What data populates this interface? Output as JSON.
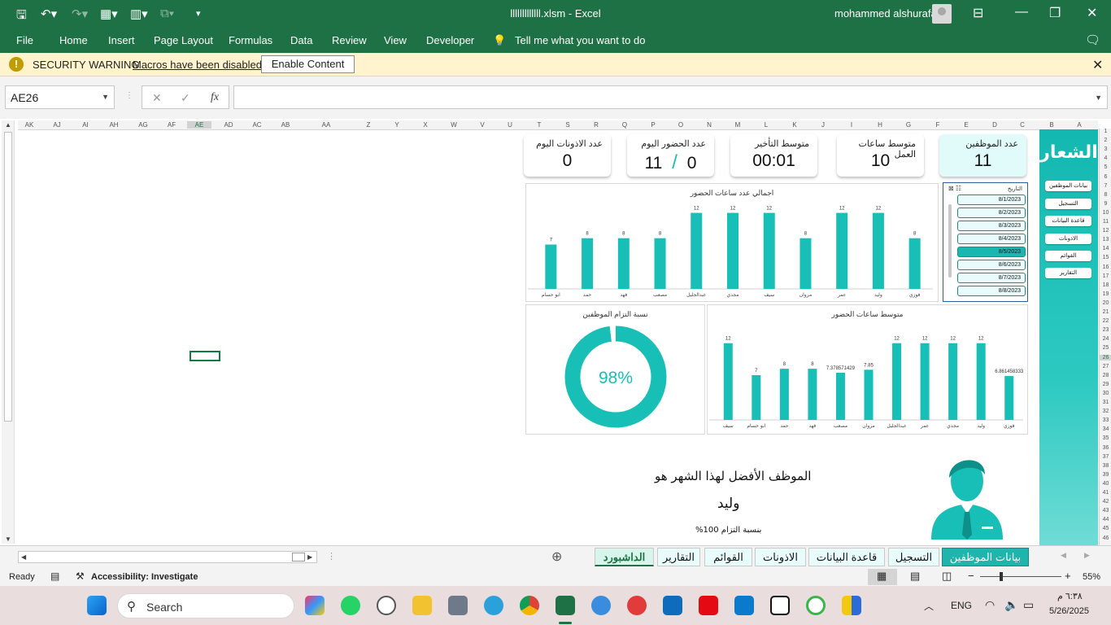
{
  "titlebar": {
    "doc_title": "lllllllllllll.xlsm  -  Excel",
    "user_name": "mohammed alshurafa"
  },
  "menu": [
    "File",
    "Home",
    "Insert",
    "Page Layout",
    "Formulas",
    "Data",
    "Review",
    "View",
    "Developer"
  ],
  "tell_me": "Tell me what you want to do",
  "security": {
    "title": "SECURITY WARNING",
    "message": "Macros have been disabled.",
    "button": "Enable Content"
  },
  "formula_bar": {
    "name_box": "AE26",
    "cancel_glyph": "✕",
    "enter_glyph": "✓",
    "fx_label": "fx",
    "value": ""
  },
  "column_headers": [
    "AK",
    "AJ",
    "AI",
    "AH",
    "AG",
    "AF",
    "AE",
    "AD",
    "AC",
    "AB",
    "AA",
    "Z",
    "Y",
    "X",
    "W",
    "V",
    "U",
    "T",
    "S",
    "R",
    "Q",
    "P",
    "O",
    "N",
    "M",
    "L",
    "K",
    "J",
    "I",
    "H",
    "G",
    "F",
    "E",
    "D",
    "C",
    "B",
    "A"
  ],
  "row_headers": [
    "1",
    "2",
    "3",
    "4",
    "5",
    "6",
    "7",
    "8",
    "9",
    "10",
    "11",
    "12",
    "13",
    "14",
    "15",
    "16",
    "17",
    "18",
    "19",
    "20",
    "21",
    "22",
    "23",
    "24",
    "25",
    "26",
    "27",
    "28",
    "29",
    "30",
    "31",
    "32",
    "33",
    "34",
    "35",
    "36",
    "37",
    "38",
    "39",
    "40",
    "41",
    "42",
    "43",
    "44",
    "45",
    "46"
  ],
  "sidebar": {
    "logo": "الشعار",
    "buttons": [
      "بيانات الموظفين",
      "التسجيل",
      "قاعدة البيانات",
      "الاذونات",
      "القوائم",
      "التقارير"
    ]
  },
  "kpis": [
    {
      "title": "عدد الموظفين",
      "value": "11"
    },
    {
      "title": "متوسط ساعات العمل",
      "value": "10"
    },
    {
      "title": "متوسط التأخير",
      "value": "00:01"
    },
    {
      "title": "عدد الحضور اليوم",
      "value_left": "11",
      "value_sep": "/",
      "value_right": "0"
    },
    {
      "title": "عدد الاذونات اليوم",
      "value": "0"
    }
  ],
  "slicer": {
    "header": "التاريخ",
    "items": [
      "8/1/2023",
      "8/2/2023",
      "8/3/2023",
      "8/4/2023",
      "8/5/2023",
      "8/6/2023",
      "8/7/2023",
      "8/8/2023"
    ],
    "selected_index": 4
  },
  "chart_data": [
    {
      "type": "bar",
      "title": "اجمالي عدد ساعات الحضور",
      "categories": [
        "فوزي",
        "وليد",
        "عمر",
        "مروان",
        "سيف",
        "مجدي",
        "عبدالجليل",
        "مصعب",
        "فهد",
        "حمد",
        "ابو حسام"
      ],
      "values": [
        8,
        12,
        12,
        8,
        12,
        12,
        12,
        8,
        8,
        8,
        7
      ],
      "data_labels": [
        "8",
        "12",
        "12",
        "8",
        "12",
        "12",
        "12",
        "8",
        "8",
        "8",
        "7"
      ],
      "color": "#17bfb6",
      "ylim": [
        0,
        14
      ]
    },
    {
      "type": "bar",
      "title": "متوسط ساعات الحضور",
      "categories": [
        "فوزي",
        "وليد",
        "مجدي",
        "عمر",
        "عبدالجليل",
        "مروان",
        "مصعب",
        "فهد",
        "حمد",
        "ابو حسام",
        "سيف"
      ],
      "values": [
        6.861458333,
        12,
        12,
        12,
        12,
        7.85,
        7.378571429,
        8,
        8,
        7,
        12
      ],
      "data_labels": [
        "6.861458333",
        "12",
        "12",
        "12",
        "12",
        "7.85",
        "7.378571429",
        "8",
        "8",
        "7",
        "12"
      ],
      "color": "#17bfb6",
      "ylim": [
        0,
        14
      ]
    },
    {
      "type": "pie",
      "title": "نسبة التزام الموظفين",
      "values": [
        98,
        2
      ],
      "center_label": "98%",
      "color": "#17bfb6"
    }
  ],
  "best_employee": {
    "line1": "الموظف الأفضل لهذا الشهر هو",
    "name": "وليد",
    "rate": "بنسبة التزام 100%"
  },
  "tabs": [
    {
      "label": "بيانات الموظفين",
      "state": "active"
    },
    {
      "label": "التسجيل",
      "state": ""
    },
    {
      "label": "قاعدة البيانات",
      "state": ""
    },
    {
      "label": "الاذونات",
      "state": ""
    },
    {
      "label": "القوائم",
      "state": ""
    },
    {
      "label": "التقارير",
      "state": ""
    },
    {
      "label": "الداشبورد",
      "state": "current"
    }
  ],
  "status": {
    "ready": "Ready",
    "accessibility": "Accessibility: Investigate",
    "zoom": "55%"
  },
  "taskbar": {
    "search": "Search",
    "lang": "ENG",
    "time": "٦:٣٨ م",
    "date": "5/26/2025"
  },
  "colors": {
    "excel_green": "#1e7145",
    "accent": "#17bfb6"
  }
}
